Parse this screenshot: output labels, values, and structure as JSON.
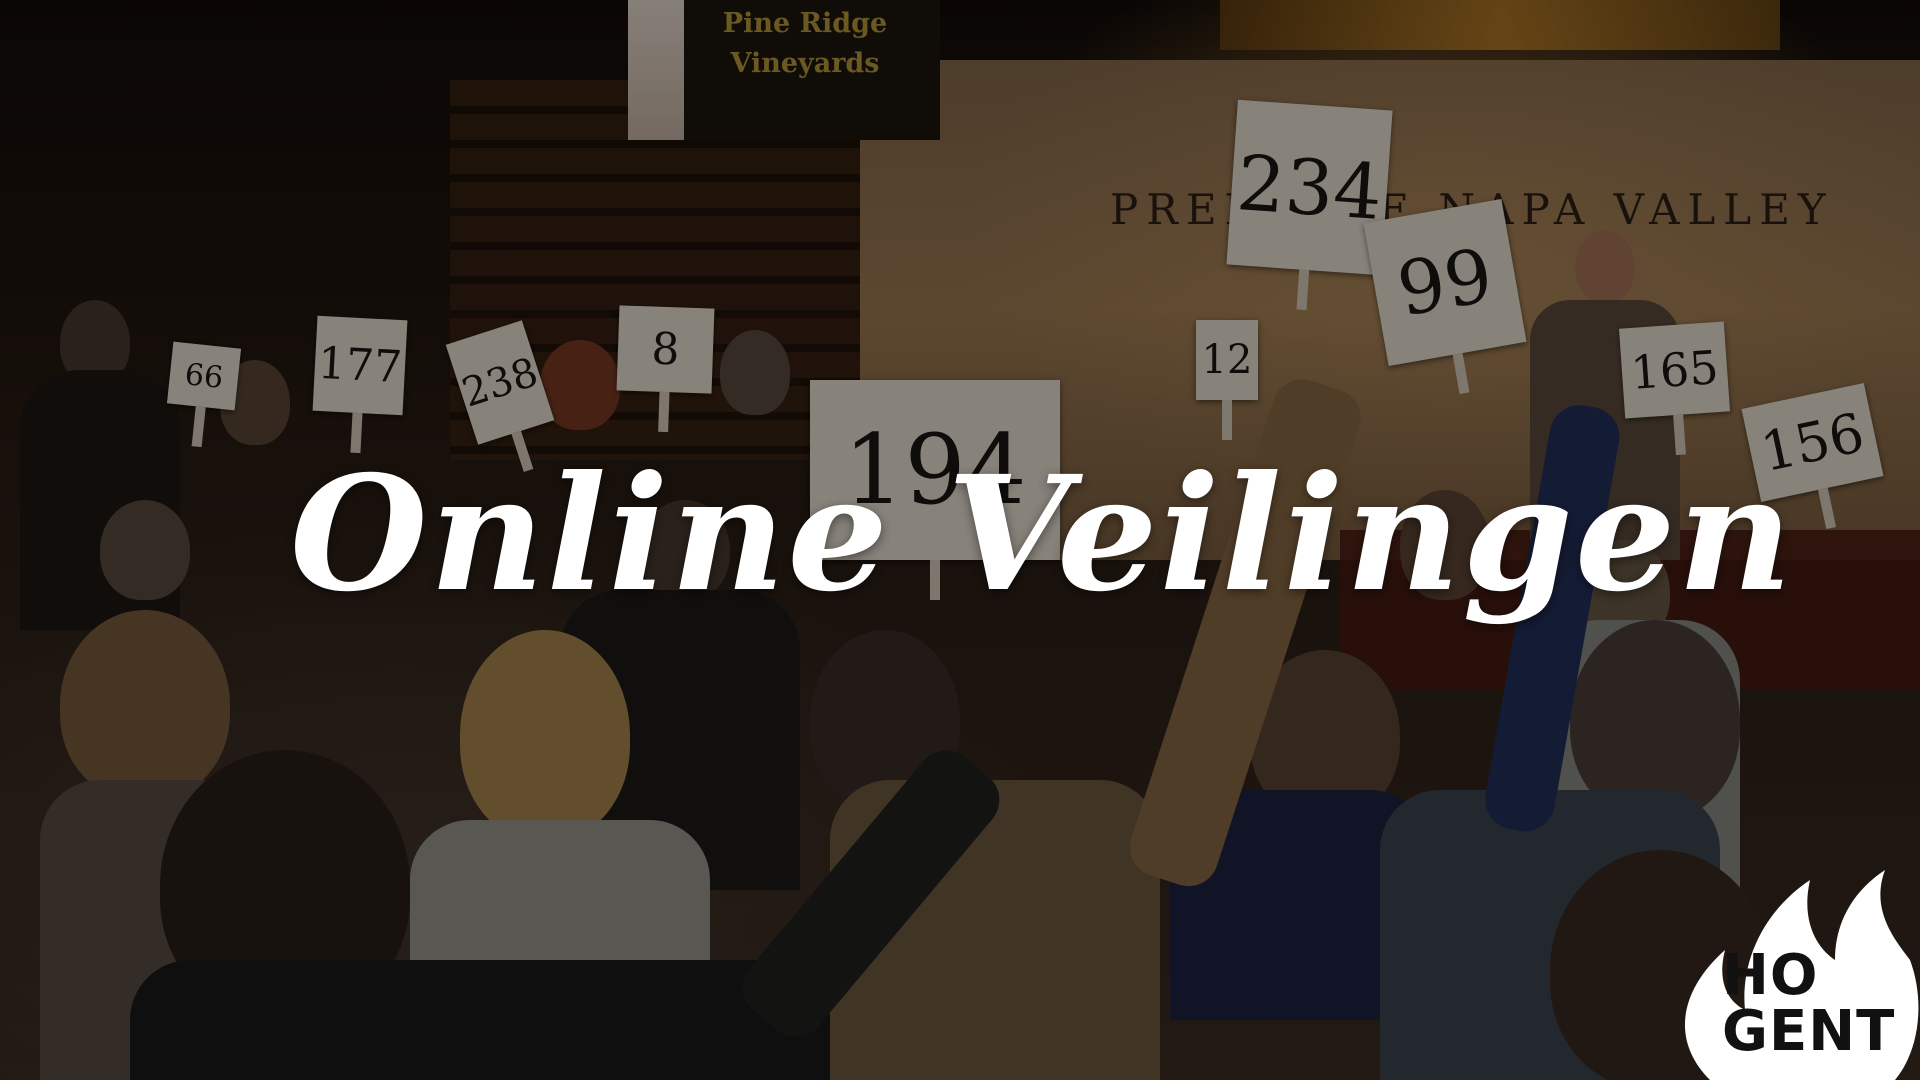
{
  "slide": {
    "title": "Online Veilingen"
  },
  "background_photo": {
    "sponsor_sign": "Pine Ridge Vineyards",
    "banner": "PREMIERE NAPA VALLEY",
    "paddles": [
      {
        "number": "66"
      },
      {
        "number": "177"
      },
      {
        "number": "238"
      },
      {
        "number": "8"
      },
      {
        "number": "194"
      },
      {
        "number": "234"
      },
      {
        "number": "99"
      },
      {
        "number": "12"
      },
      {
        "number": "165"
      },
      {
        "number": "156"
      }
    ]
  },
  "logo": {
    "line1": "HO",
    "line2": "GENT",
    "icon": "flame-icon",
    "color": "#ffffff"
  }
}
